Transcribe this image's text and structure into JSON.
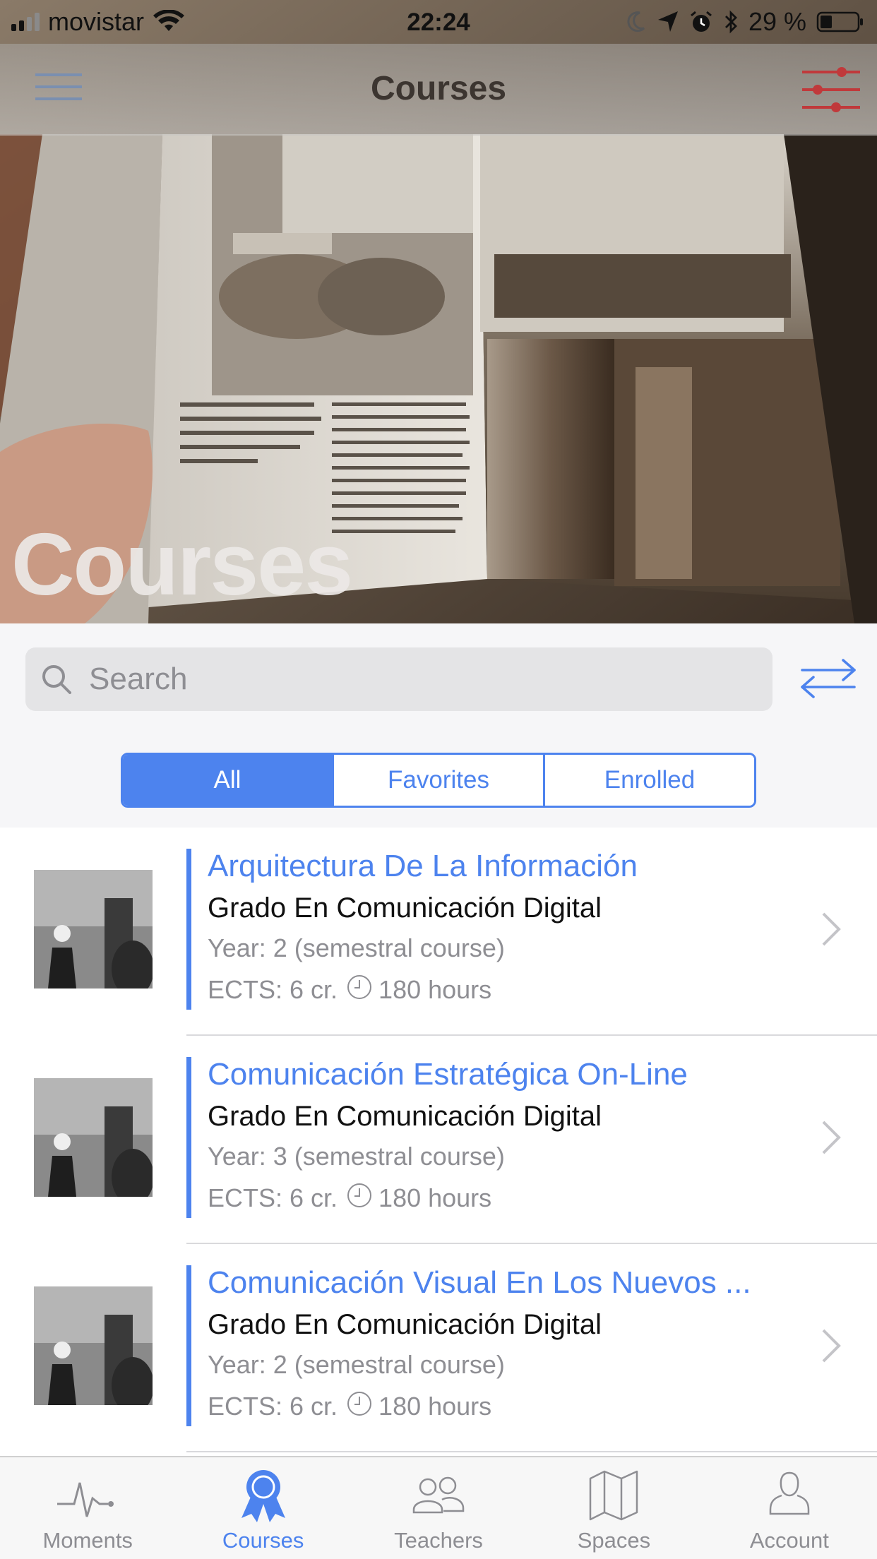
{
  "status_bar": {
    "carrier": "movistar",
    "time": "22:24",
    "battery": "29 %"
  },
  "nav": {
    "title": "Courses"
  },
  "hero": {
    "title": "Courses"
  },
  "search": {
    "placeholder": "Search"
  },
  "segments": {
    "all": "All",
    "favorites": "Favorites",
    "enrolled": "Enrolled",
    "selected": "All"
  },
  "courses": [
    {
      "title": "Arquitectura De La Información",
      "degree": "Grado En Comunicación Digital",
      "year": "Year: 2 (semestral course)",
      "ects": "ECTS: 6 cr.",
      "hours": "180 hours"
    },
    {
      "title": "Comunicación Estratégica On-Line",
      "degree": "Grado En Comunicación Digital",
      "year": "Year: 3 (semestral course)",
      "ects": "ECTS: 6 cr.",
      "hours": "180 hours"
    },
    {
      "title": "Comunicación Visual En Los Nuevos ...",
      "degree": "Grado En Comunicación Digital",
      "year": "Year: 2 (semestral course)",
      "ects": "ECTS: 6 cr.",
      "hours": "180 hours"
    }
  ],
  "tabs": {
    "moments": "Moments",
    "courses": "Courses",
    "teachers": "Teachers",
    "spaces": "Spaces",
    "account": "Account",
    "active": "Courses"
  },
  "colors": {
    "accent": "#4d83ee",
    "secondary_text": "#8e8e93",
    "filter_icon": "#c0393b"
  }
}
